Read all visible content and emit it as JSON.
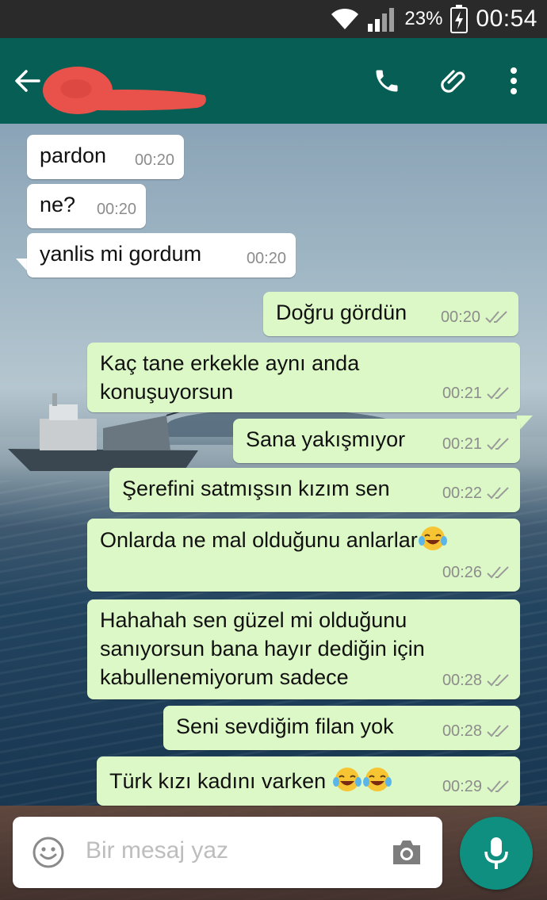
{
  "status_bar": {
    "battery": "23%",
    "time": "00:54"
  },
  "chat_header": {
    "contact_name": ""
  },
  "messages": [
    {
      "dir": "in",
      "lines": [
        "pardon"
      ],
      "time": "00:20"
    },
    {
      "dir": "in",
      "lines": [
        "ne?"
      ],
      "time": "00:20"
    },
    {
      "dir": "in",
      "lines": [
        "yanlis mi gordum"
      ],
      "time": "00:20"
    },
    {
      "dir": "out",
      "lines": [
        "Doğru gördün"
      ],
      "time": "00:20",
      "read": true
    },
    {
      "dir": "out",
      "lines": [
        "Kaç tane erkekle aynı anda",
        "konuşuyorsun"
      ],
      "time": "00:21",
      "read": true
    },
    {
      "dir": "out",
      "lines": [
        "Sana yakışmıyor"
      ],
      "time": "00:21",
      "read": true
    },
    {
      "dir": "out",
      "lines": [
        "Şerefini satmışsın kızım sen"
      ],
      "time": "00:22",
      "read": true
    },
    {
      "dir": "out",
      "lines": [
        "Onlarda ne mal olduğunu anlarlar"
      ],
      "emojis": 1,
      "time": "00:26",
      "read": true
    },
    {
      "dir": "out",
      "lines": [
        "Hahahah sen güzel mi olduğunu",
        "sanıyorsun bana hayır dediğin için",
        "kabullenemiyorum sadece"
      ],
      "time": "00:28",
      "read": true
    },
    {
      "dir": "out",
      "lines": [
        "Seni sevdiğim filan yok"
      ],
      "time": "00:28",
      "read": true
    },
    {
      "dir": "out",
      "lines": [
        "Türk kızı kadını varken "
      ],
      "emojis": 2,
      "time": "00:29",
      "read": true
    }
  ],
  "composer": {
    "placeholder": "Bir mesaj yaz"
  },
  "icons": {
    "back": "arrow-left-icon",
    "call": "phone-icon",
    "attach": "paperclip-icon",
    "menu": "more-vert-icon",
    "emoji": "smiley-icon",
    "camera": "camera-icon",
    "mic": "microphone-icon",
    "ticks": "double-check-icon"
  },
  "colors": {
    "app_bar": "#075e54",
    "status_bar": "#2a2a2a",
    "bubble_out": "#dcf8c6",
    "bubble_in": "#ffffff",
    "mic_button": "#0e8f7f",
    "redaction": "#e8524a"
  }
}
